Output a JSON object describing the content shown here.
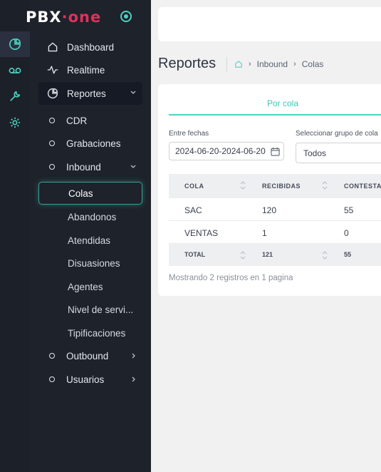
{
  "brand": {
    "prefix": "PBX",
    "sep": "·",
    "suffix": "one"
  },
  "colors": {
    "accent": "#4fd1c1",
    "brand_red": "#e0315c",
    "sidebar": "#1e222b"
  },
  "rail": [
    {
      "icon": "pie-chart-icon",
      "active": true
    },
    {
      "icon": "voicemail-icon",
      "active": false
    },
    {
      "icon": "wrench-icon",
      "active": false
    },
    {
      "icon": "gear-icon",
      "active": false
    }
  ],
  "menu": {
    "dashboard": "Dashboard",
    "realtime": "Realtime",
    "reportes": "Reportes",
    "cdr": "CDR",
    "grabaciones": "Grabaciones",
    "inbound": "Inbound",
    "inbound_children": [
      "Colas",
      "Abandonos",
      "Atendidas",
      "Disuasiones",
      "Agentes",
      "Nivel de servi...",
      "Tipificaciones"
    ],
    "outbound": "Outbound",
    "usuarios": "Usuarios"
  },
  "page": {
    "title": "Reportes"
  },
  "breadcrumb": [
    "Inbound",
    "Colas"
  ],
  "tab": "Por cola",
  "filters": {
    "date_label": "Entre fechas",
    "date_value": "2024-06-20-2024-06-20",
    "group_label": "Seleccionar grupo de cola",
    "group_value": "Todos"
  },
  "table": {
    "columns": [
      "COLA",
      "RECIBIDAS",
      "CONTESTA"
    ],
    "rows": [
      [
        "SAC",
        "120",
        "55"
      ],
      [
        "VENTAS",
        "1",
        "0"
      ]
    ],
    "total": [
      "TOTAL",
      "121",
      "55"
    ]
  },
  "info": "Mostrando 2 registros en 1 pagina"
}
